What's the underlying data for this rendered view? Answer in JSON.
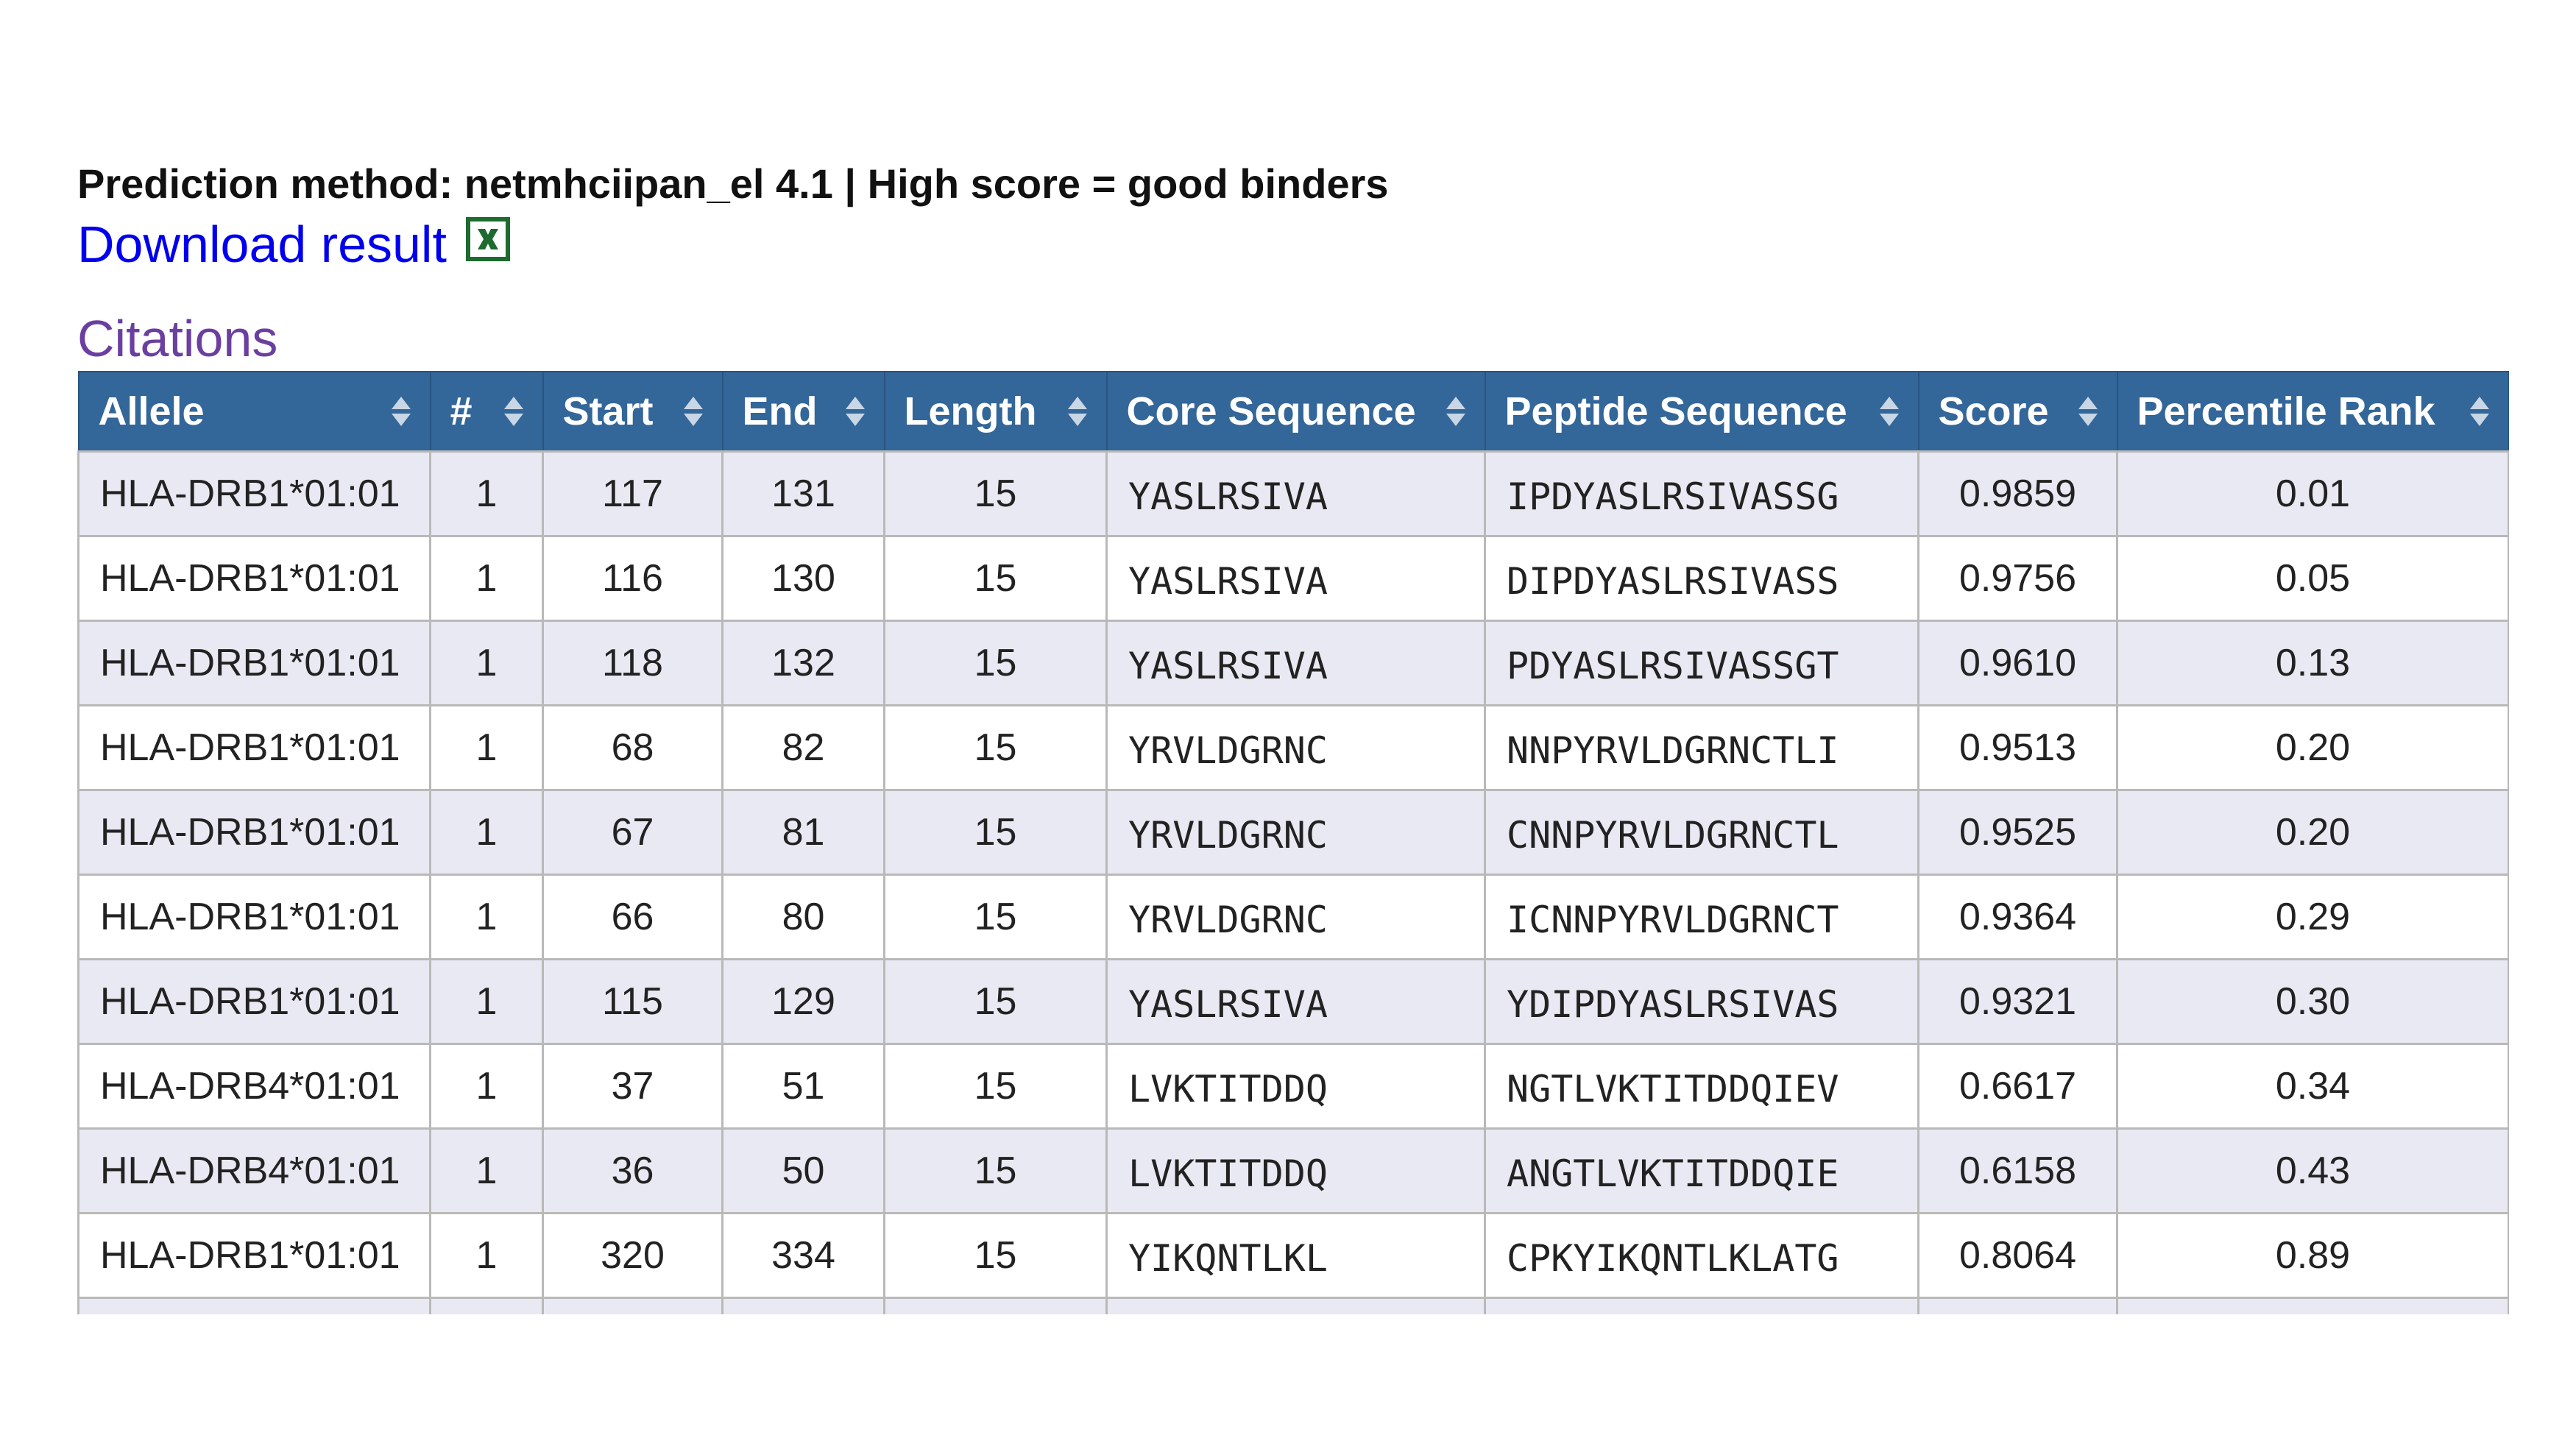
{
  "header": {
    "method_text": "Prediction method: netmhciipan_el 4.1 | High score = good binders",
    "download_label": "Download result",
    "download_icon": "excel-file-icon",
    "citations_label": "Citations"
  },
  "colors": {
    "header_bg": "#336699",
    "odd_row_bg": "#e9e9f3",
    "link": "#0000ee",
    "visited_link": "#6b3fa0",
    "excel_green": "#1d6b2e"
  },
  "table": {
    "columns": [
      {
        "label": "Allele",
        "sort_icon": "sort-icon"
      },
      {
        "label": "#",
        "sort_icon": "sort-icon"
      },
      {
        "label": "Start",
        "sort_icon": "sort-icon"
      },
      {
        "label": "End",
        "sort_icon": "sort-icon"
      },
      {
        "label": "Length",
        "sort_icon": "sort-icon"
      },
      {
        "label": "Core Sequence",
        "sort_icon": "sort-icon"
      },
      {
        "label": "Peptide Sequence",
        "sort_icon": "sort-icon"
      },
      {
        "label": "Score",
        "sort_icon": "sort-icon"
      },
      {
        "label": "Percentile Rank",
        "sort_icon": "sort-icon"
      }
    ],
    "rows": [
      [
        "HLA-DRB1*01:01",
        "1",
        "117",
        "131",
        "15",
        "YASLRSIVA",
        "IPDYASLRSIVASSG",
        "0.9859",
        "0.01"
      ],
      [
        "HLA-DRB1*01:01",
        "1",
        "116",
        "130",
        "15",
        "YASLRSIVA",
        "DIPDYASLRSIVASS",
        "0.9756",
        "0.05"
      ],
      [
        "HLA-DRB1*01:01",
        "1",
        "118",
        "132",
        "15",
        "YASLRSIVA",
        "PDYASLRSIVASSGT",
        "0.9610",
        "0.13"
      ],
      [
        "HLA-DRB1*01:01",
        "1",
        "68",
        "82",
        "15",
        "YRVLDGRNC",
        "NNPYRVLDGRNCTLI",
        "0.9513",
        "0.20"
      ],
      [
        "HLA-DRB1*01:01",
        "1",
        "67",
        "81",
        "15",
        "YRVLDGRNC",
        "CNNPYRVLDGRNCTL",
        "0.9525",
        "0.20"
      ],
      [
        "HLA-DRB1*01:01",
        "1",
        "66",
        "80",
        "15",
        "YRVLDGRNC",
        "ICNNPYRVLDGRNCT",
        "0.9364",
        "0.29"
      ],
      [
        "HLA-DRB1*01:01",
        "1",
        "115",
        "129",
        "15",
        "YASLRSIVA",
        "YDIPDYASLRSIVAS",
        "0.9321",
        "0.30"
      ],
      [
        "HLA-DRB4*01:01",
        "1",
        "37",
        "51",
        "15",
        "LVKTITDDQ",
        "NGTLVKTITDDQIEV",
        "0.6617",
        "0.34"
      ],
      [
        "HLA-DRB4*01:01",
        "1",
        "36",
        "50",
        "15",
        "LVKTITDDQ",
        "ANGTLVKTITDDQIE",
        "0.6158",
        "0.43"
      ],
      [
        "HLA-DRB1*01:01",
        "1",
        "320",
        "334",
        "15",
        "YIKQNTLKL",
        "CPKYIKQNTLKLATG",
        "0.8064",
        "0.89"
      ]
    ]
  }
}
